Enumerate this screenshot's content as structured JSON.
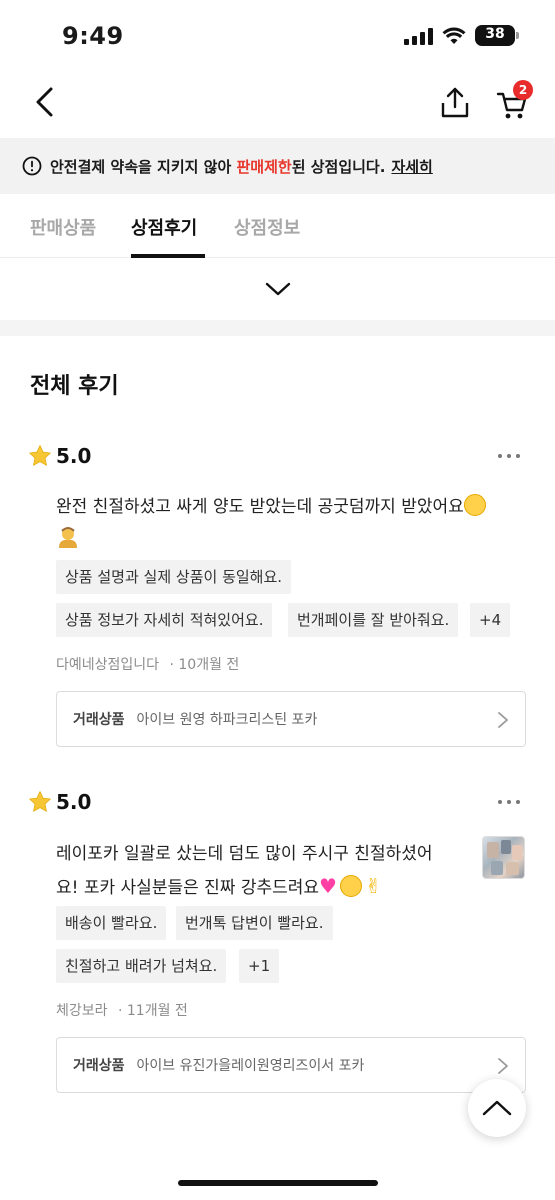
{
  "status_bar": {
    "time": "9:49",
    "battery": "38"
  },
  "nav": {
    "cart_count": "2"
  },
  "notice": {
    "text_before": "안전결제 약속을 지키지 않아 ",
    "highlight": "판매제한",
    "text_after": "된 상점입니다.",
    "link": "자세히",
    "highlight_color": "#e8372c"
  },
  "tabs": [
    {
      "label": "판매상품",
      "active": false
    },
    {
      "label": "상점후기",
      "active": true
    },
    {
      "label": "상점정보",
      "active": false
    }
  ],
  "section_title": "전체 후기",
  "reviews": [
    {
      "rating": "5.0",
      "text_line1": "완전 친절하셨고 싸게 양도 받았는데 공굿덤까지 받았어요",
      "tags": [
        "상품 설명과 실제 상품이 동일해요.",
        "상품 정보가 자세히 적혀있어요.",
        "번개페이를 잘 받아줘요.",
        "+4"
      ],
      "author": "다예네상점입니다",
      "time": "· 10개월 전",
      "trade_label": "거래상품",
      "trade_item": "아이브 원영 하파크리스틴 포카"
    },
    {
      "rating": "5.0",
      "text_line1": "레이포카 일괄로 샀는데 덤도 많이 주시구 친절하셨어",
      "text_line2": "요! 포카 사실분들은 진짜 강추드려요",
      "tags": [
        "배송이 빨라요.",
        "번개톡 답변이 빨라요.",
        "친절하고 배려가 넘쳐요.",
        "+1"
      ],
      "author": "체강보라",
      "time": "· 11개월 전",
      "trade_label": "거래상품",
      "trade_item": "아이브 유진가을레이원영리즈이서 포카"
    }
  ],
  "icons": {
    "back": "chevron-left-icon",
    "share": "share-icon",
    "cart": "cart-icon",
    "notice": "exclamation-circle-icon",
    "expand": "chevron-down-icon",
    "star": "star-icon",
    "more": "more-dots-icon",
    "trade_chevron": "chevron-right-icon",
    "scroll_top": "chevron-up-icon"
  },
  "colors": {
    "star": "#f7c634",
    "badge": "#e82c2c"
  }
}
